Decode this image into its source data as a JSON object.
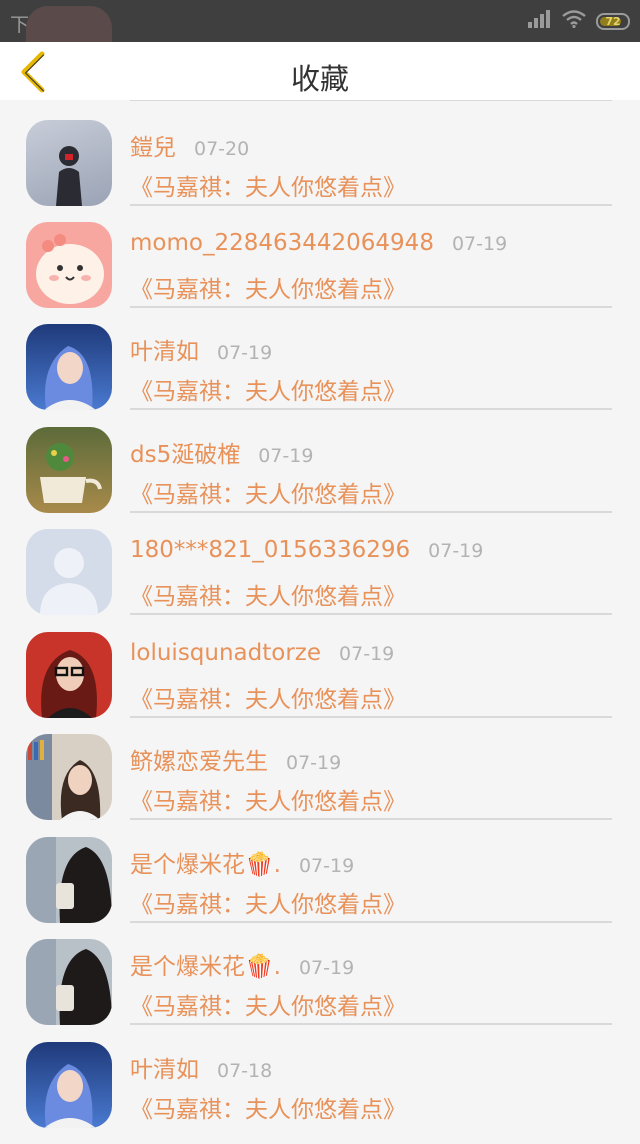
{
  "status_bar": {
    "time": "下午4:16",
    "battery": "72"
  },
  "header": {
    "title": "收藏"
  },
  "items": [
    {
      "name": "鎧兒",
      "date": "07-20",
      "book": "《马嘉祺：夫人你悠着点》",
      "avatar": "girl-silhouette"
    },
    {
      "name": "momo_228463442064948",
      "date": "07-19",
      "book": "《马嘉祺：夫人你悠着点》",
      "avatar": "cartoon-blob"
    },
    {
      "name": "叶清如",
      "date": "07-19",
      "book": "《马嘉祺：夫人你悠着点》",
      "avatar": "blue-hair-girl"
    },
    {
      "name": "ds5涎破榷",
      "date": "07-19",
      "book": "《马嘉祺：夫人你悠着点》",
      "avatar": "flower-pot"
    },
    {
      "name": "180***821_0156336296",
      "date": "07-19",
      "book": "《马嘉祺：夫人你悠着点》",
      "avatar": "default-user"
    },
    {
      "name": "loluisqunadtorze",
      "date": "07-19",
      "book": "《马嘉祺：夫人你悠着点》",
      "avatar": "red-hair-girl"
    },
    {
      "name": "鲚嫘恋爱先生",
      "date": "07-19",
      "book": "《马嘉祺：夫人你悠着点》",
      "avatar": "bookshelf-girl"
    },
    {
      "name": "是个爆米花🍿.",
      "date": "07-19",
      "book": "《马嘉祺：夫人你悠着点》",
      "avatar": "photo-girl"
    },
    {
      "name": "是个爆米花🍿.",
      "date": "07-19",
      "book": "《马嘉祺：夫人你悠着点》",
      "avatar": "photo-girl"
    },
    {
      "name": "叶清如",
      "date": "07-18",
      "book": "《马嘉祺：夫人你悠着点》",
      "avatar": "blue-hair-girl"
    }
  ],
  "colors": {
    "accent": "#e8925a",
    "back_arrow": "#e8b800"
  }
}
